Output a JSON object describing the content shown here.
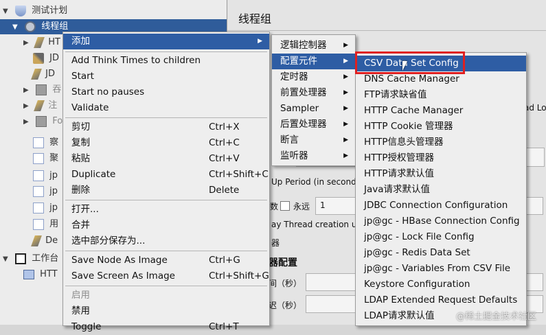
{
  "tree": {
    "items": [
      {
        "label": "测试计划"
      },
      {
        "label": "线程组"
      },
      {
        "label": "HT"
      },
      {
        "label": "JD"
      },
      {
        "label": "JD"
      },
      {
        "label": "吞"
      },
      {
        "label": "注"
      },
      {
        "label": "Fo"
      },
      {
        "label": "察"
      },
      {
        "label": "聚"
      },
      {
        "label": "jp"
      },
      {
        "label": "jp"
      },
      {
        "label": "jp"
      },
      {
        "label": "用"
      },
      {
        "label": "De"
      },
      {
        "label": "工作台"
      },
      {
        "label": "HTT"
      }
    ]
  },
  "pane": {
    "title": "线程组",
    "frag_load": "ad Lo",
    "frag_rampup": "Up Period (in seconds)",
    "frag_forever_prefix": "数",
    "frag_forever": "永远",
    "loop_value": "1",
    "frag_delay": "ay Thread creation unt",
    "frag_scheduler": "器",
    "frag_config": "器配置",
    "frag_duration": "间（秒）",
    "frag_startup": "迟（秒）"
  },
  "menu1": {
    "add": "添加",
    "add_think_times": "Add Think Times to children",
    "start": "Start",
    "start_no_pauses": "Start no pauses",
    "validate": "Validate",
    "cut": "剪切",
    "cut_sc": "Ctrl+X",
    "copy": "复制",
    "copy_sc": "Ctrl+C",
    "paste": "粘贴",
    "paste_sc": "Ctrl+V",
    "duplicate": "Duplicate",
    "duplicate_sc": "Ctrl+Shift+C",
    "delete": "删除",
    "delete_sc": "Delete",
    "open": "打开...",
    "merge": "合并",
    "save_selection": "选中部分保存为...",
    "save_node_image": "Save Node As Image",
    "save_node_image_sc": "Ctrl+G",
    "save_screen_image": "Save Screen As Image",
    "save_screen_image_sc": "Ctrl+Shift+G",
    "enable": "启用",
    "disable": "禁用",
    "toggle": "Toggle",
    "toggle_sc": "Ctrl+T"
  },
  "menu2": {
    "items": [
      {
        "label": "逻辑控制器"
      },
      {
        "label": "配置元件"
      },
      {
        "label": "定时器"
      },
      {
        "label": "前置处理器"
      },
      {
        "label": "Sampler"
      },
      {
        "label": "后置处理器"
      },
      {
        "label": "断言"
      },
      {
        "label": "监听器"
      }
    ]
  },
  "menu3": {
    "items": [
      {
        "label": "CSV Data Set Config"
      },
      {
        "label": "DNS Cache Manager"
      },
      {
        "label": "FTP请求缺省值"
      },
      {
        "label": "HTTP Cache Manager"
      },
      {
        "label": "HTTP Cookie 管理器"
      },
      {
        "label": "HTTP信息头管理器"
      },
      {
        "label": "HTTP授权管理器"
      },
      {
        "label": "HTTP请求默认值"
      },
      {
        "label": "Java请求默认值"
      },
      {
        "label": "JDBC Connection Configuration"
      },
      {
        "label": "jp@gc - HBase Connection Config"
      },
      {
        "label": "jp@gc - Lock File Config"
      },
      {
        "label": "jp@gc - Redis Data Set"
      },
      {
        "label": "jp@gc - Variables From CSV File"
      },
      {
        "label": "Keystore Configuration"
      },
      {
        "label": "LDAP Extended Request Defaults"
      },
      {
        "label": "LDAP请求默认值"
      }
    ]
  },
  "watermark": "@稀土掘金技术社区",
  "colors": {
    "highlight": "#2e5da4",
    "callout": "#e02020",
    "menu_bg": "#eeeeee"
  }
}
